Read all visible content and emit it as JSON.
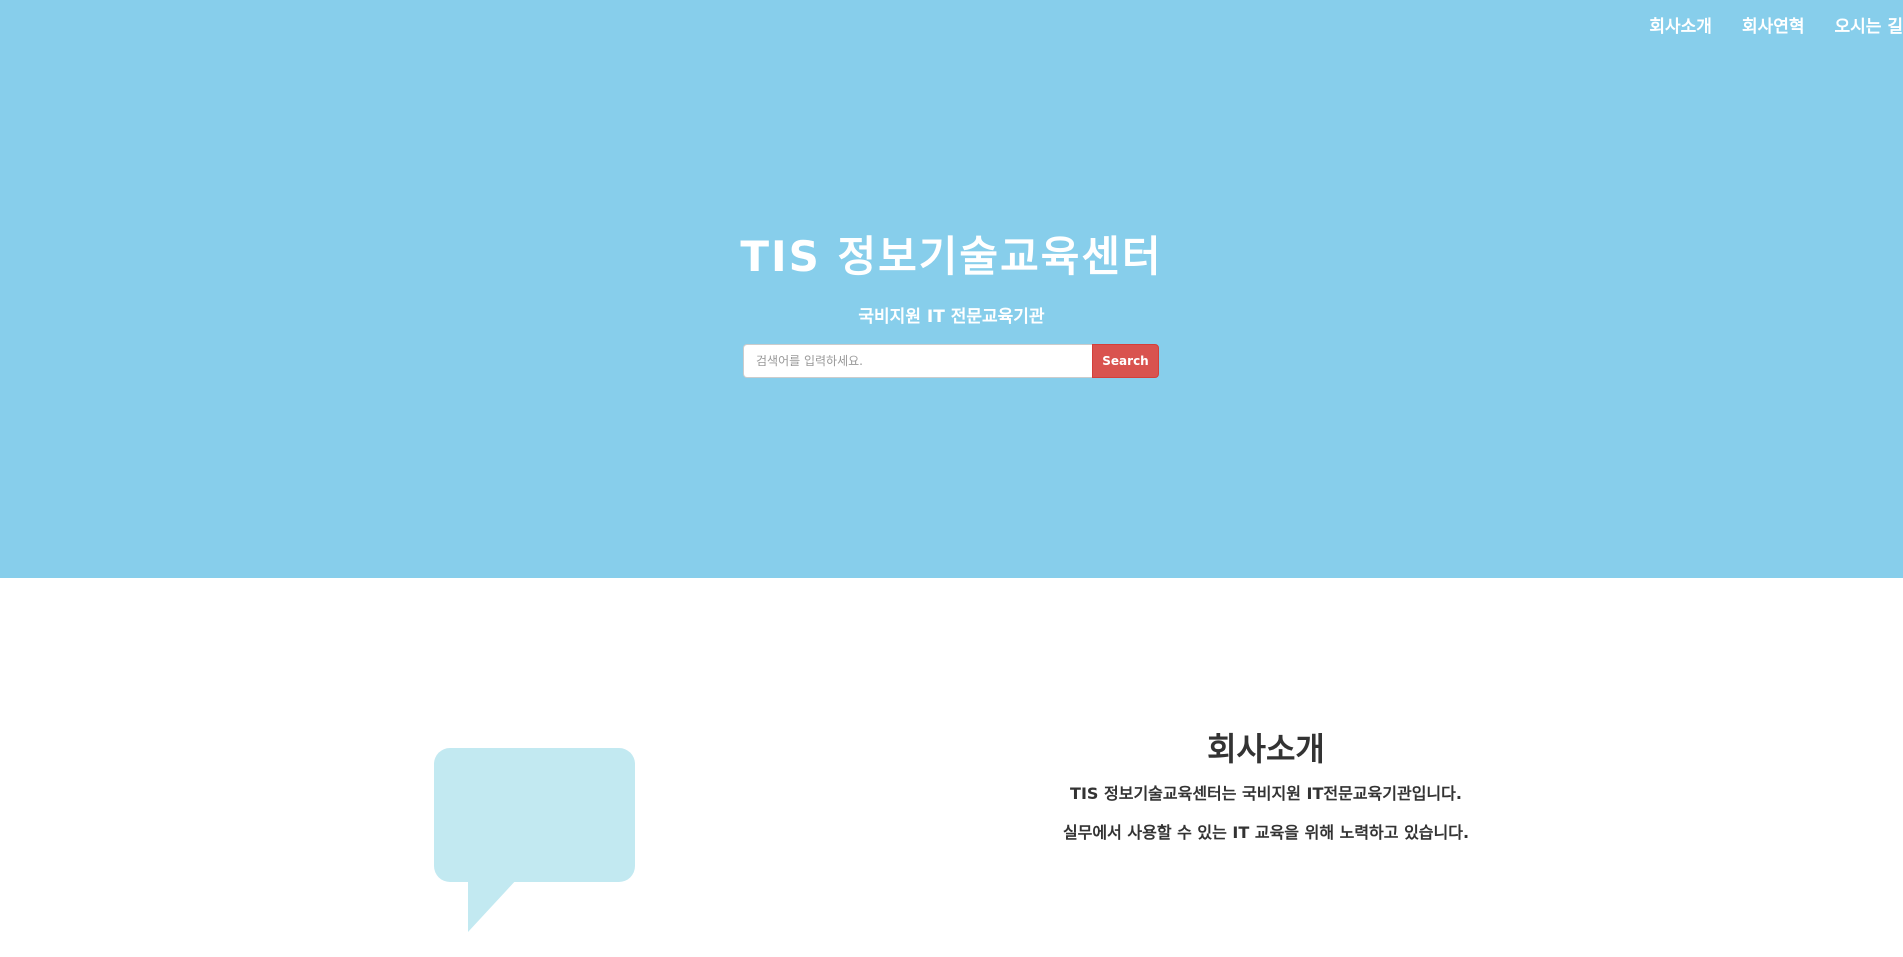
{
  "nav": {
    "items": [
      {
        "label": "회사소개"
      },
      {
        "label": "회사연혁"
      },
      {
        "label": "오시는 길"
      }
    ]
  },
  "hero": {
    "title": "TIS 정보기술교육센터",
    "subtitle": "국비지원 IT 전문교육기관",
    "background_color": "#87ceeb"
  },
  "search": {
    "placeholder": "검색어를 입력하세요.",
    "button_label": "Search",
    "button_color": "#d9534f"
  },
  "about": {
    "icon": "speech-bubble-icon",
    "icon_color": "#c2e9f1",
    "title": "회사소개",
    "line1": "TIS 정보기술교육센터는 국비지원 IT전문교육기관입니다.",
    "line2": "실무에서 사용할 수 있는 IT 교육을 위해 노력하고 있습니다."
  }
}
